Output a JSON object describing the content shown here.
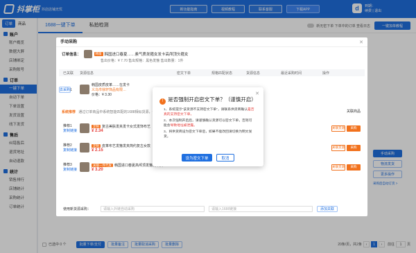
{
  "app": {
    "name": "抖掌柜",
    "sub": "抖店店铺无忧",
    "topbar_buttons": [
      "新功能指南",
      "视频教程",
      "联系客服",
      "下载APP"
    ]
  },
  "user": {
    "avatar": "d",
    "line1": "到期：",
    "line2": "续费 | 退出"
  },
  "sidebar": {
    "tabs": [
      "订单",
      "商品"
    ],
    "sections": [
      {
        "title": "账户",
        "items": [
          "账户概览",
          "数据大屏",
          "店铺绑定",
          "采购账号"
        ]
      },
      {
        "title": "订单",
        "items": [
          "一键下单",
          "自动下单",
          "下单设置",
          "发货设置",
          "线下发货"
        ]
      },
      {
        "title": "售后",
        "items": [
          "纠错售后",
          "退货地址",
          "自动退款"
        ]
      },
      {
        "title": "统计",
        "items": [
          "销售排行",
          "店铺统计",
          "采购统计",
          "订单统计"
        ]
      }
    ],
    "active": "一键下单"
  },
  "main": {
    "tabs": [
      "1688一键下单",
      "私拍检测"
    ],
    "right_text": "新无密下单 下单中的订单 查看日志",
    "pin_button": "一键加单教程",
    "side_buttons": [
      "手动采购",
      "物流发货",
      "更多操作"
    ],
    "side_link": "采购后自动订货 >"
  },
  "panel": {
    "title": "手动采购",
    "order_label": "订单信息：",
    "order_tag": "韩版",
    "order_name": "韩国进口春夏……素气质发箍女发卡高颅顶头箍女",
    "order_meta": "售出价格：¥ 7.70  售出规格：黑色发箍  售出数量：1件",
    "headers": [
      "已关联",
      "货源信息",
      "",
      "密文下单",
      "规格匹配状态",
      "货源信息",
      "最近采购时间",
      "操作"
    ],
    "source_row": {
      "label": "货源1",
      "name": "韩国皮质皮革……在发卡",
      "shop": "义乌市徐轩饰品有限…",
      "price": "价格：¥ 3.30",
      "action": "去采购"
    },
    "similar_title": "系统推荐",
    "similar_hint": "通过订单商品中系统智能匹配的1688相似货源，请 你去确认后选择下单",
    "similar_header": "关联商品",
    "similar": [
      {
        "label": "推荐1",
        "link": "复制链接",
        "name": "复古美肤发夹发卡女式发饰布艺",
        "price": "¥ 2.34",
        "b1": "关联货源",
        "b2": "采购"
      },
      {
        "label": "推荐2",
        "link": "复制链接",
        "name": "皮革布艺发箍发夹简约复古女款",
        "price": "¥ 2.15",
        "b1": "关联货源",
        "b2": "采购"
      },
      {
        "label": "推荐3",
        "link": "复制链接",
        "name": "韩国进口春夏高颅顶发箍发卡女",
        "price": "¥ 3.20",
        "b1": "关联货源",
        "b2": "采购"
      }
    ],
    "similar_tags": [
      "定制",
      "定制",
      "关联一件代发"
    ],
    "search_placeholder_1": "请输入外链自动采购",
    "search_placeholder_2": "请输入1688链接",
    "search_btn": "添加关联",
    "search_label": "使用新货源采购："
  },
  "dialog": {
    "title": "是否强制开启密文下单？（谨慎开启）",
    "lines": [
      {
        "n": "1、",
        "t": "系统提示“该货源不支持密文下单”，请联系供货商确认",
        "r": "是否真的支持密文下单，"
      },
      {
        "n": "2、",
        "t": "本次强制开启后，请谨慎确认货源可以密文下单，否则可能会",
        "r": "导致地址被泄露。"
      },
      {
        "n": "3、",
        "t": "将供货商设为密文下单后，如果不能改回请切换为明文发货。",
        "r": ""
      }
    ],
    "ok": "设为密文下单",
    "cancel": "取消"
  },
  "footer": {
    "select_all": "已选中 0 个",
    "buttons": [
      "批量下单/支付",
      "批量备注",
      "批量取消采购",
      "批量删除"
    ],
    "total": "20条/页，共2条",
    "page": "1",
    "goto": "前往",
    "goto_val": "1",
    "page_unit": "页"
  }
}
